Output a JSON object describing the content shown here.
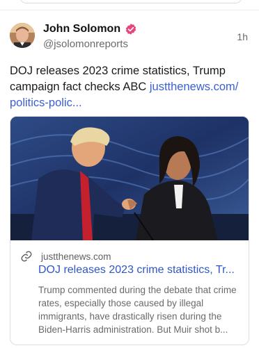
{
  "post": {
    "author_name": "John Solomon",
    "author_handle": "@jsolomonreports",
    "timestamp": "1h",
    "verified_icon": "verified-badge-icon",
    "text_body": "DOJ releases 2023 crime statistics, Trump campaign fact checks ABC ",
    "text_link": "justthenews.com/ politics-polic...",
    "link_card": {
      "domain": "justthenews.com",
      "title": "DOJ releases 2023 crime statistics, Tr...",
      "description": "Trump commented during the debate that crime rates, especially those caused by illegal immigrants, have drastically risen during the Biden-Harris administration. But Muir shot b..."
    }
  },
  "colors": {
    "link": "#3a5fd6",
    "verified": "#e8457a",
    "muted_text": "#6a6a6a"
  }
}
